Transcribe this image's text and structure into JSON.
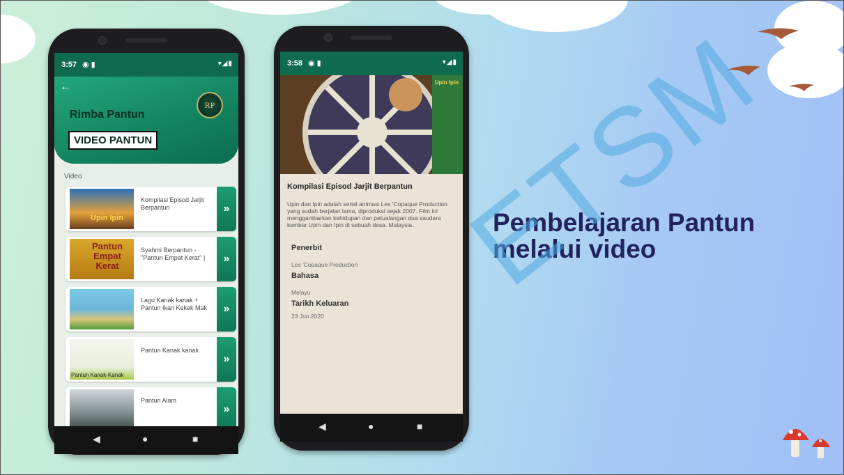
{
  "headline": "Pembelajaran Pantun melalui video",
  "watermark": "ETSM",
  "phone1": {
    "status_time": "3:57",
    "app_title": "Rimba Pantun",
    "logo_text": "RP",
    "section_button": "VIDEO PANTUN",
    "list_label": "Video",
    "videos": [
      {
        "title": "Kompilasi Episod Jarjit Berpantun",
        "thumb_text": "Upin Ipin"
      },
      {
        "title": "Syahmi Berpantun - \"Pantun Empat Kerat\" |",
        "thumb_text": "Pantun Empat Kerat"
      },
      {
        "title": "Lagu Kanak kanak + Pantun Ikan Kekek Mak",
        "thumb_text": ""
      },
      {
        "title": "Pantun Kanak kanak",
        "thumb_text": "Pantun Kanak-Kanak"
      },
      {
        "title": "Pantun Alam",
        "thumb_text": ""
      }
    ],
    "play_glyph": "»"
  },
  "phone2": {
    "status_time": "3:58",
    "video_badge": "Upin Ipin",
    "title": "Kompilasi Episod Jarjit Berpantun",
    "description": "Upin dan Ipin adalah serial animasi Les 'Copaque Production yang sudah berjalan lama, diproduksi sejak 2007. Film ini menggambarkan kehidupan dan petualangan dua saudara kembar Upin dan Ipin di sebuah desa. Malaysia.",
    "publisher_label": "Penerbit",
    "publisher": "Les 'Copaque Production",
    "language_label": "Bahasa",
    "language": "Melayu",
    "release_label": "Tarikh Keluaran",
    "release_date": "23 Jun 2020"
  },
  "nav": {
    "back": "◀",
    "home": "●",
    "recents": "■"
  },
  "colors": {
    "app_green": "#0e6b4f",
    "headline": "#22235e",
    "watermark": "#50aae1"
  }
}
